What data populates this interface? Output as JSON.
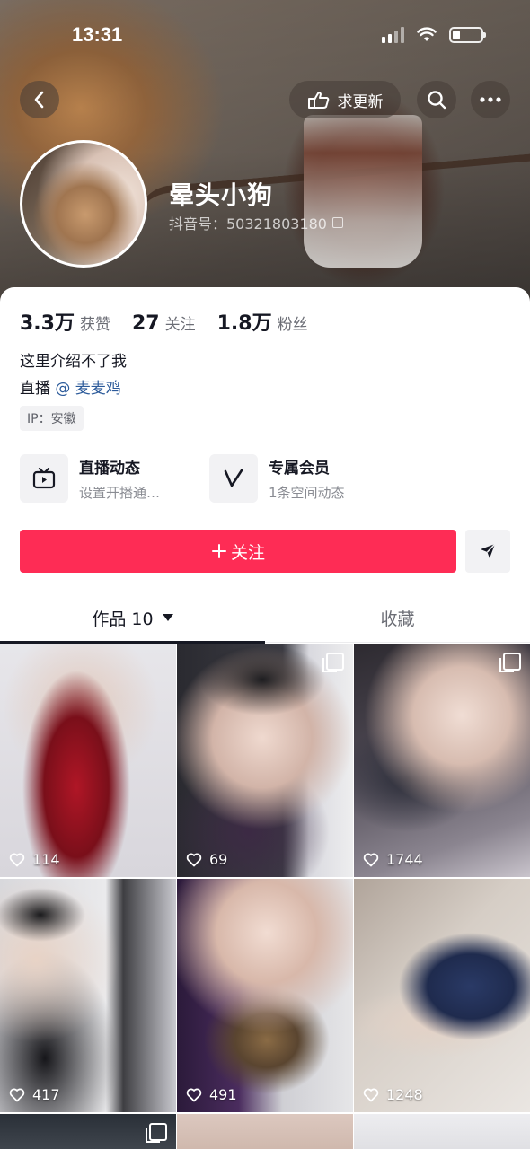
{
  "status_bar": {
    "time": "13:31"
  },
  "header": {
    "update_label": "求更新",
    "name": "晕头小狗",
    "id_label": "抖音号：50321803180"
  },
  "stats": [
    {
      "value": "3.3万",
      "label": "获赞"
    },
    {
      "value": "27",
      "label": "关注"
    },
    {
      "value": "1.8万",
      "label": "粉丝"
    }
  ],
  "bio": {
    "line1": "这里介绍不了我",
    "line2_prefix": "直播 ",
    "mention": "@ 麦麦鸡"
  },
  "ip_tag": "IP：安徽",
  "features": [
    {
      "title": "直播动态",
      "subtitle": "设置开播通…",
      "icon": "tv-icon"
    },
    {
      "title": "专属会员",
      "subtitle": "1条空间动态",
      "icon": "v-icon"
    }
  ],
  "follow_button": {
    "label": "关注",
    "icon": "plus-icon"
  },
  "tabs": [
    {
      "label": "作品 10"
    },
    {
      "label": "收藏"
    }
  ],
  "posts": [
    {
      "likes": "114",
      "multi": false
    },
    {
      "likes": "69",
      "multi": true
    },
    {
      "likes": "1744",
      "multi": true
    },
    {
      "likes": "417",
      "multi": false
    },
    {
      "likes": "491",
      "multi": false
    },
    {
      "likes": "1248",
      "multi": false
    }
  ],
  "colors": {
    "accent": "#fe2c55",
    "mention": "#2b5a9a"
  }
}
